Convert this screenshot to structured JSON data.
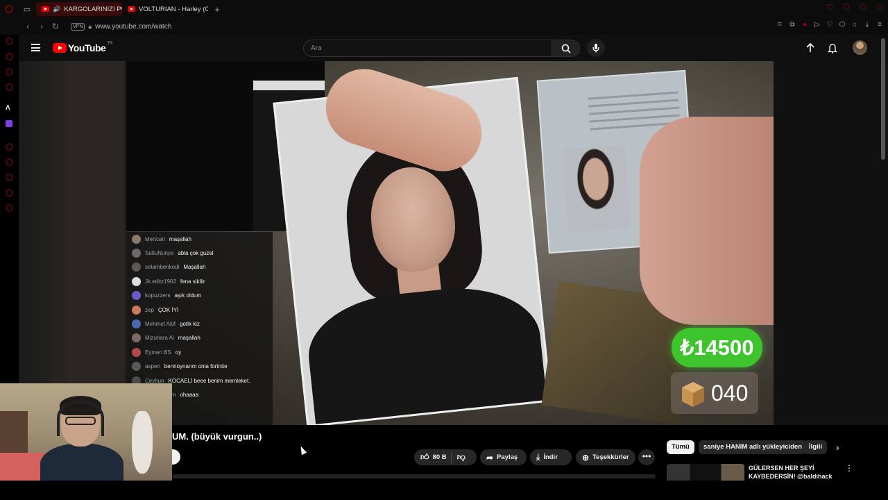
{
  "browser": {
    "tabs": [
      {
        "label": "KARGOLARINIZI PUAN",
        "active": true,
        "playing": true
      },
      {
        "label": "VOLTURIAN - Harley (Off",
        "active": false,
        "playing": false
      }
    ],
    "new_tab_label": "+",
    "vpn_label": "VPN",
    "url": "www.youtube.com/watch"
  },
  "youtube": {
    "logo_text": "YouTube",
    "region": "TR",
    "search_placeholder": "Ara"
  },
  "video": {
    "price_overlay": "₺14500",
    "box_count": "040",
    "chat": [
      {
        "user": "Mertcan",
        "msg": "maşallah",
        "avatar_color": "#8a7a6a"
      },
      {
        "user": "SutluNuriye",
        "msg": "abla çok guzel",
        "avatar_color": "#6a6a6a"
      },
      {
        "user": "selambenkedi",
        "msg": "Maşallah",
        "avatar_color": "#5a5a5a"
      },
      {
        "user": "Jk.editz1903",
        "msg": "fena sikilir",
        "avatar_color": "#ddd"
      },
      {
        "user": "kopuzzers",
        "msg": "aşık oldum",
        "avatar_color": "#6a5acd"
      },
      {
        "user": "zep",
        "msg": "ÇOK İYİ",
        "avatar_color": "#c87a5a"
      },
      {
        "user": "Mehmet Akif",
        "msg": "gotik kiz",
        "avatar_color": "#4a6ab0"
      },
      {
        "user": "Mizuhara Ai",
        "msg": "maşallah",
        "avatar_color": "#7a6a6a"
      },
      {
        "user": "Eymen BS",
        "msg": "oy",
        "avatar_color": "#b04a4a"
      },
      {
        "user": "aspen",
        "msg": "bennoynarım onla fortnite",
        "avatar_color": "#5a5a5a"
      },
      {
        "user": "Ceyhun",
        "msg": "KOCAELİ beee benim memleket.",
        "avatar_color": "#4a4a4a"
      },
      {
        "user": "ahmetkerem",
        "msg": "ohaaaa",
        "avatar_color": "#5a5a5a"
      }
    ]
  },
  "below_video": {
    "title": "UM. (büyük vurgun..)",
    "like_count": "80 B",
    "share_label": "Paylaş",
    "download_label": "İndir",
    "thanks_label": "Teşekkürler",
    "more_label": "•••"
  },
  "sidebar_right": {
    "chips": [
      {
        "label": "Tümü",
        "active": true
      },
      {
        "label": "saniye HANIM adlı yükleyiciden",
        "active": false
      },
      {
        "label": "İlgili",
        "active": false
      }
    ],
    "recommendation": {
      "title": "GÜLERSEN HER ŞEYİ KAYBEDERSİN! @baldihack"
    }
  }
}
